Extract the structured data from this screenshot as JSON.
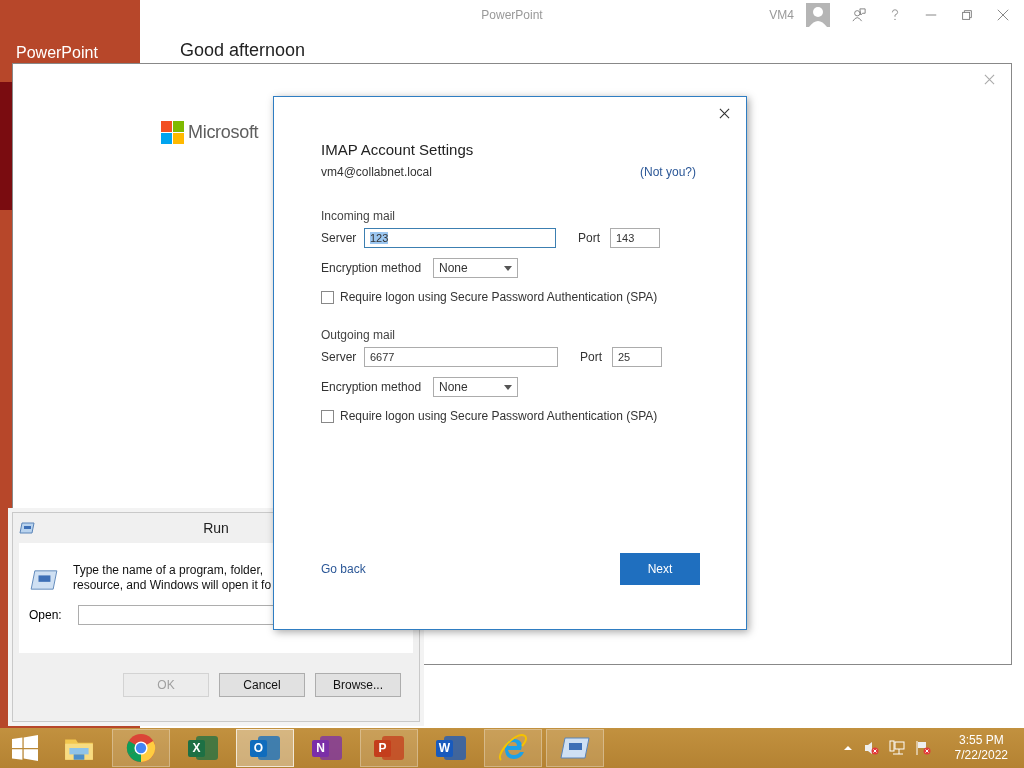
{
  "app_window": {
    "title": "PowerPoint",
    "user": "VM4",
    "sidebar_title": "PowerPoint",
    "greeting": "Good afternoon"
  },
  "signin_dialog": {
    "brand": "Microsoft"
  },
  "imap_dialog": {
    "title": "IMAP Account Settings",
    "email": "vm4@collabnet.local",
    "not_you_link": "(Not you?)",
    "sections": [
      {
        "heading": "Incoming mail",
        "server_label": "Server",
        "server": "123",
        "focused": true,
        "port_label": "Port",
        "port": "143",
        "encryption_label": "Encryption method",
        "encryption": "None",
        "spa_label": "Require logon using Secure Password Authentication (SPA)",
        "spa_checked": false
      },
      {
        "heading": "Outgoing mail",
        "server_label": "Server",
        "server": "6677",
        "focused": false,
        "port_label": "Port",
        "port": "25",
        "encryption_label": "Encryption method",
        "encryption": "None",
        "spa_label": "Require logon using Secure Password Authentication (SPA)",
        "spa_checked": false
      }
    ],
    "back_link": "Go back",
    "next_button": "Next"
  },
  "run_dialog": {
    "title": "Run",
    "description_lines": [
      "Type the name of a program, folder,",
      "resource, and Windows will open it fo"
    ],
    "open_label": "Open:",
    "buttons": [
      {
        "label": "OK",
        "disabled": true
      },
      {
        "label": "Cancel",
        "disabled": false
      },
      {
        "label": "Browse...",
        "disabled": false
      }
    ]
  },
  "taskbar": {
    "apps": [
      {
        "kind": "explorer",
        "running": false,
        "selected": false
      },
      {
        "kind": "chrome",
        "running": true,
        "selected": false
      },
      {
        "kind": "office",
        "letter": "X",
        "color": "#1d7044",
        "running": false,
        "selected": false
      },
      {
        "kind": "office",
        "letter": "O",
        "color": "#0f6cbd",
        "running": true,
        "selected": true
      },
      {
        "kind": "office",
        "letter": "N",
        "color": "#7b2fa8",
        "running": false,
        "selected": false
      },
      {
        "kind": "office",
        "letter": "P",
        "color": "#c43e1c",
        "running": true,
        "selected": false
      },
      {
        "kind": "office",
        "letter": "W",
        "color": "#185abd",
        "running": false,
        "selected": false
      },
      {
        "kind": "ie",
        "running": true,
        "selected": false
      },
      {
        "kind": "run",
        "running": true,
        "selected": false
      }
    ],
    "clock": {
      "time": "3:55 PM",
      "date": "7/22/2022"
    }
  }
}
